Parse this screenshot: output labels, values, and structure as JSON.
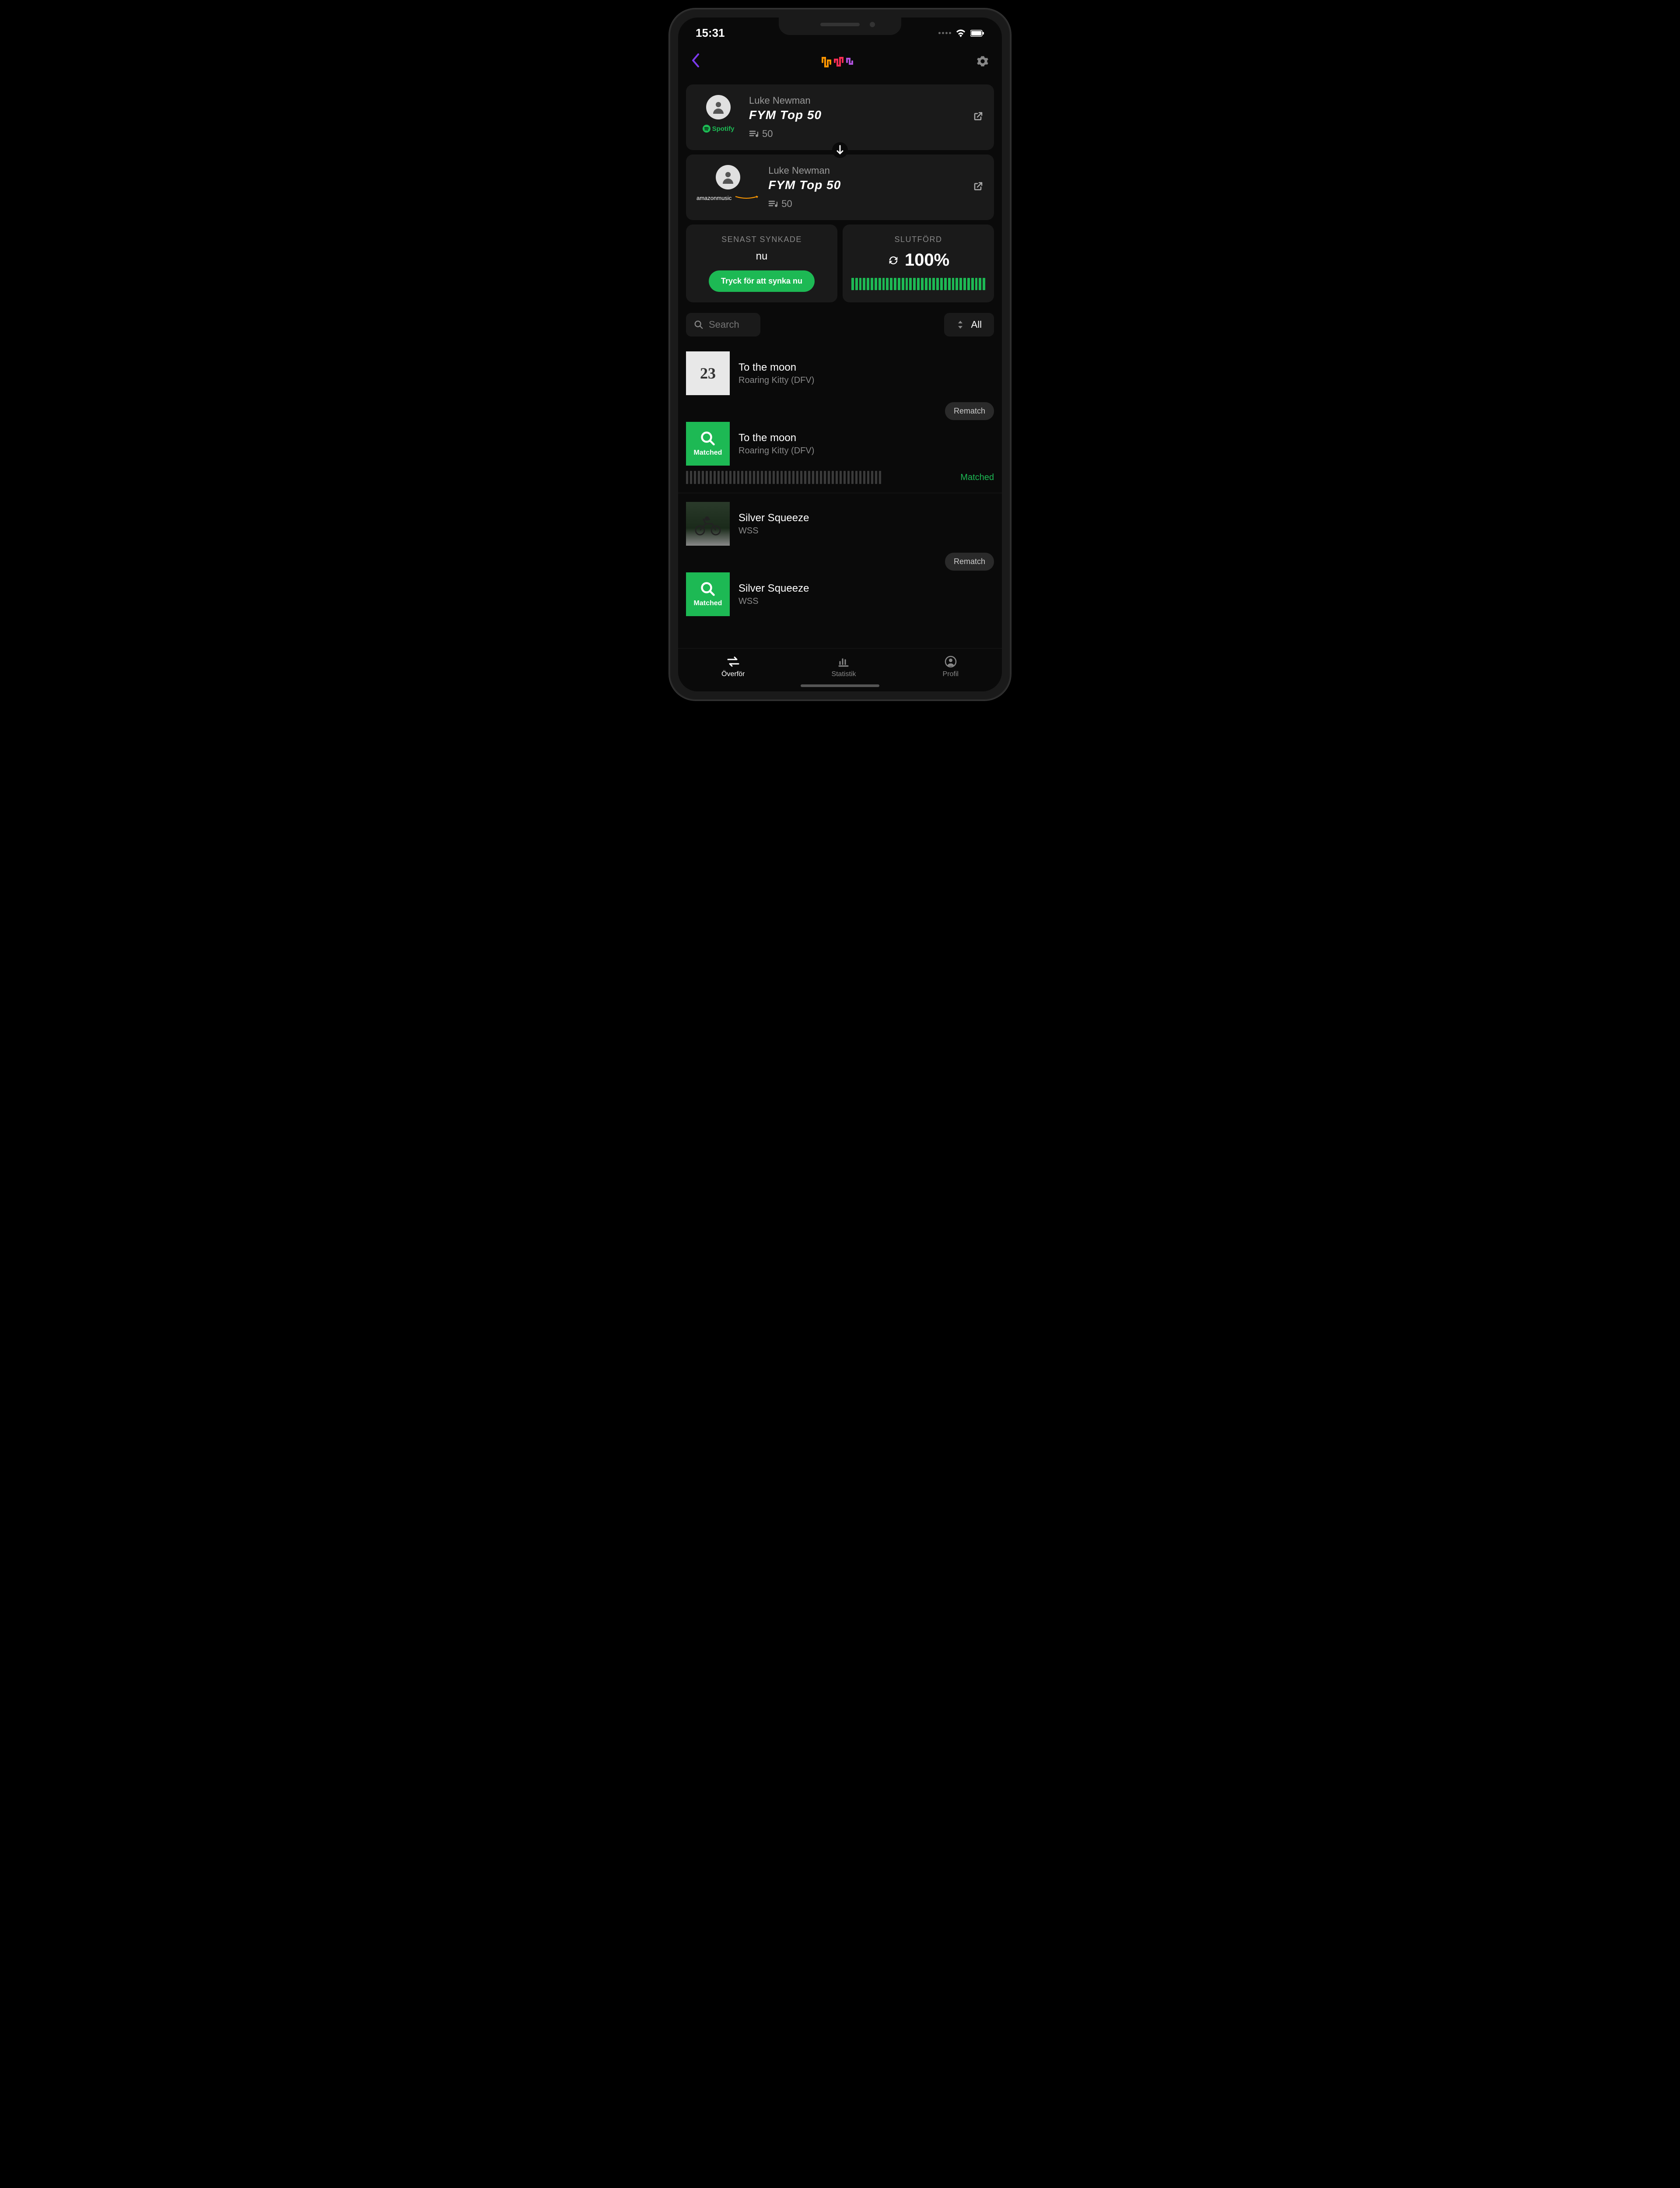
{
  "status": {
    "time": "15:31"
  },
  "source": {
    "owner": "Luke Newman",
    "title": "FYM Top 50",
    "count": "50",
    "service": "Spotify"
  },
  "dest": {
    "owner": "Luke Newman",
    "title": "FYM Top 50",
    "count": "50",
    "service_top": "amazon",
    "service_bottom": "music"
  },
  "sync": {
    "label": "SENAST SYNKADE",
    "value": "nu",
    "button": "Tryck för att synka nu"
  },
  "complete": {
    "label": "SLUTFÖRD",
    "value": "100%"
  },
  "search": {
    "placeholder": "Search"
  },
  "filter": {
    "value": "All"
  },
  "tracks": [
    {
      "src_title": "To the moon",
      "src_artist": "Roaring Kitty (DFV)",
      "art_text": "23",
      "dst_title": "To the moon",
      "dst_artist": "Roaring Kitty (DFV)",
      "matched_label": "Matched",
      "rematch": "Rematch",
      "status": "Matched"
    },
    {
      "src_title": "Silver Squeeze",
      "src_artist": "WSS",
      "dst_title": "Silver Squeeze",
      "dst_artist": "WSS",
      "matched_label": "Matched",
      "rematch": "Rematch"
    }
  ],
  "nav": {
    "transfer": "Överför",
    "stats": "Statistik",
    "profile": "Profil"
  }
}
